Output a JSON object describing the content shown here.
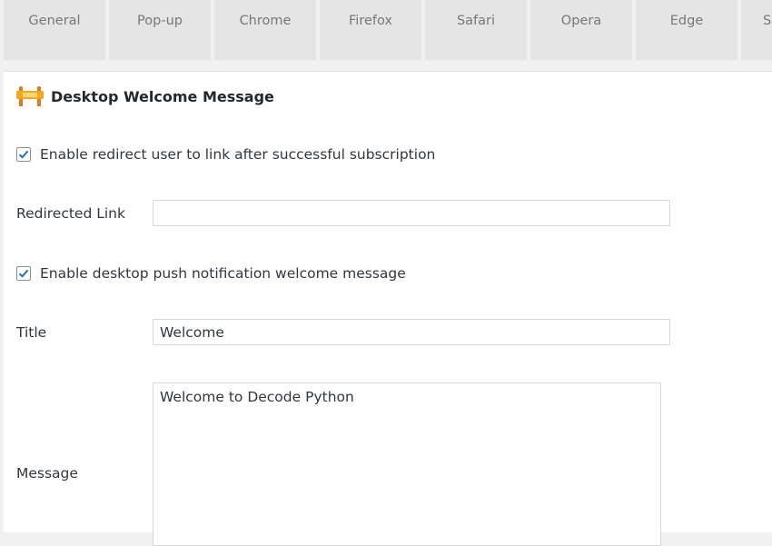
{
  "tabs": [
    {
      "label": "General"
    },
    {
      "label": "Pop-up"
    },
    {
      "label": "Chrome"
    },
    {
      "label": "Firefox"
    },
    {
      "label": "Safari"
    },
    {
      "label": "Opera"
    },
    {
      "label": "Edge"
    },
    {
      "label": "S"
    }
  ],
  "section": {
    "title": "Desktop Welcome Message",
    "icon": "welcome-sign-icon"
  },
  "redirect": {
    "checkbox_label": "Enable redirect user to link after successful subscription",
    "checked": true,
    "link_label": "Redirected Link",
    "link_value": ""
  },
  "welcome": {
    "checkbox_label": "Enable desktop push notification welcome message",
    "checked": true,
    "title_label": "Title",
    "title_value": "Welcome",
    "message_label": "Message",
    "message_value": "Welcome to Decode Python"
  },
  "colors": {
    "accent": "#2271b1",
    "tab_bg": "#e5e5e5",
    "page_bg": "#f1f1f1"
  }
}
